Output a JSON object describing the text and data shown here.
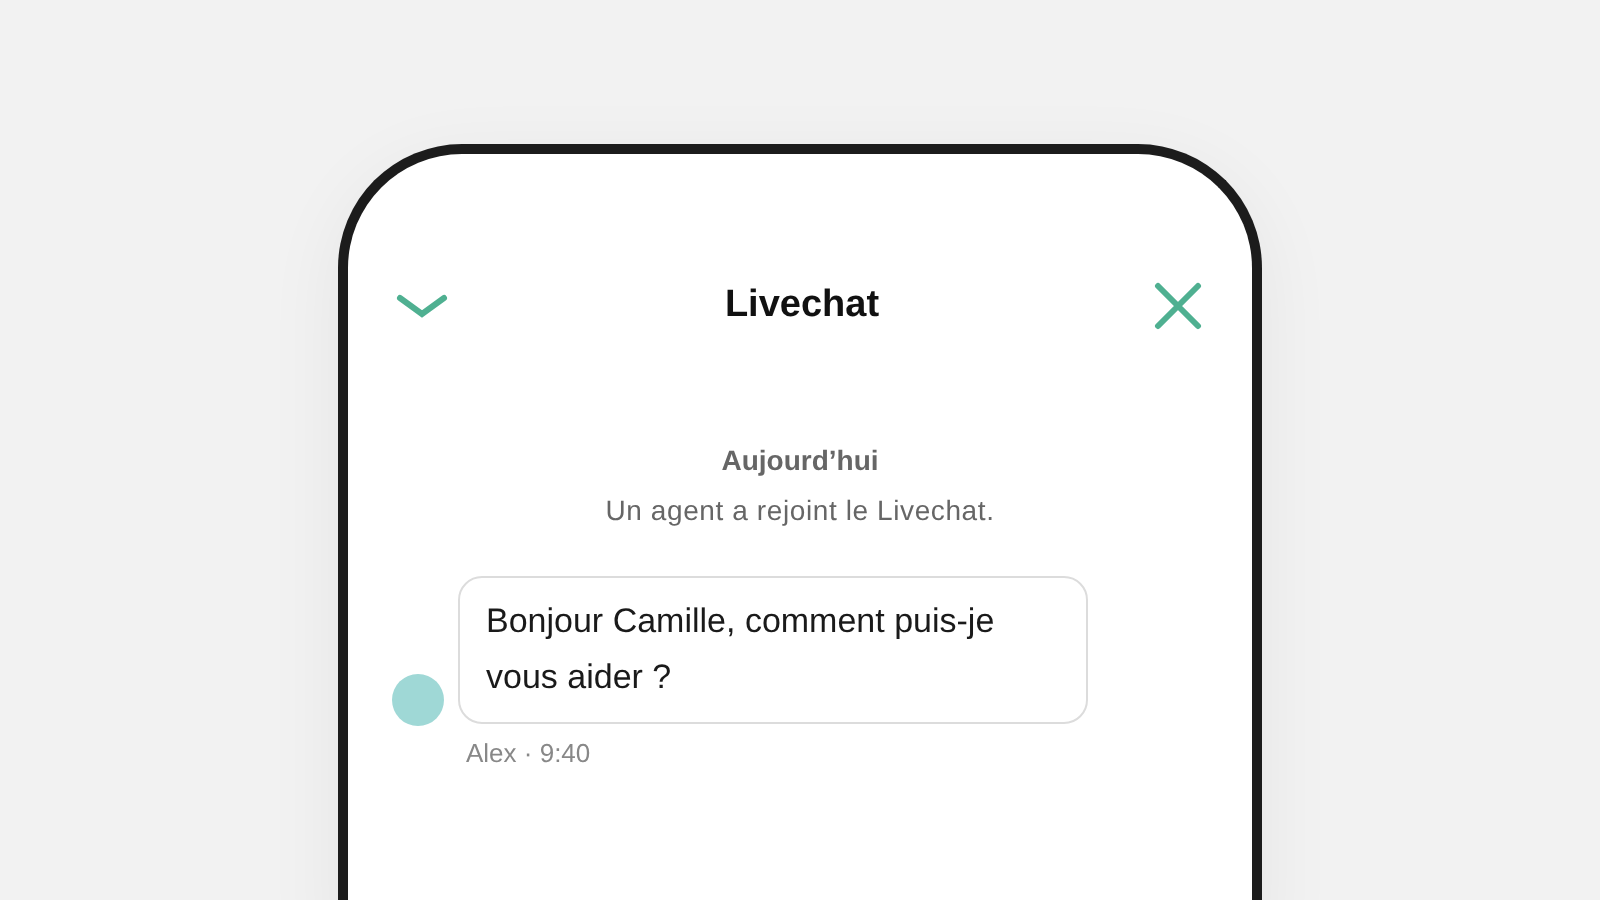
{
  "header": {
    "title": "Livechat"
  },
  "day_label": "Aujourd’hui",
  "system_message": "Un agent a rejoint le Livechat.",
  "messages": [
    {
      "text": "Bonjour Camille, comment puis-je vous aider ?",
      "meta": "Alex · 9:40"
    }
  ]
}
